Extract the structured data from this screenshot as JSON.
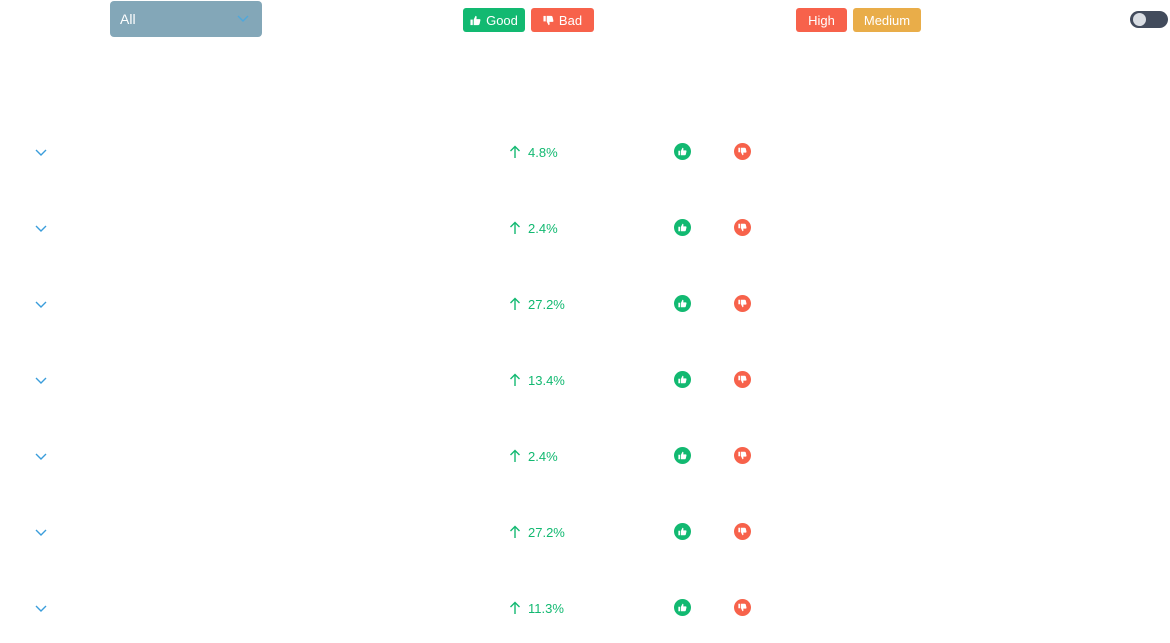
{
  "filter": {
    "selected": "All"
  },
  "sentiment_buttons": {
    "good_label": "Good",
    "bad_label": "Bad"
  },
  "priority_buttons": {
    "high_label": "High",
    "medium_label": "Medium"
  },
  "toggle": {
    "state": "off"
  },
  "rows": [
    {
      "change": "4.8%",
      "direction": "up"
    },
    {
      "change": "2.4%",
      "direction": "up"
    },
    {
      "change": "27.2%",
      "direction": "up"
    },
    {
      "change": "13.4%",
      "direction": "up"
    },
    {
      "change": "2.4%",
      "direction": "up"
    },
    {
      "change": "27.2%",
      "direction": "up"
    },
    {
      "change": "11.3%",
      "direction": "up"
    }
  ],
  "colors": {
    "good": "#12b971",
    "bad": "#f7624b",
    "medium": "#e9ad49",
    "select_bg": "#83a7b8",
    "accent_blue": "#3a9ddb",
    "toggle_track": "#424b5c"
  }
}
